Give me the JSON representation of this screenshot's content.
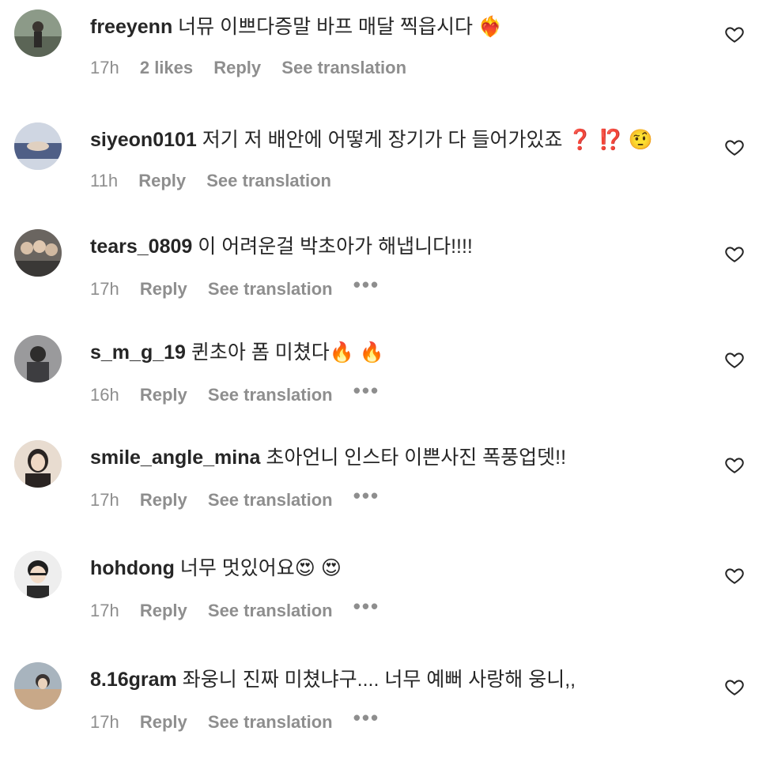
{
  "comments": [
    {
      "username": "freeyenn",
      "text": "너뮤 이쁘다증말 바프 매달 찍읍시다 ❤️‍🔥",
      "time": "17h",
      "likes": "2 likes",
      "reply_label": "Reply",
      "translate_label": "See translation",
      "more": "",
      "avatar_bg": "#6b7a6a"
    },
    {
      "username": "siyeon0101",
      "text": "저기 저 배안에 어떻게 장기가 다 들어가있죠 ❓ ⁉️ 🤨",
      "time": "11h",
      "likes": "",
      "reply_label": "Reply",
      "translate_label": "See translation",
      "more": "",
      "avatar_bg": "#4f5f86"
    },
    {
      "username": "tears_0809",
      "text": "이 어려운걸 박초아가 해냅니다!!!!",
      "time": "17h",
      "likes": "",
      "reply_label": "Reply",
      "translate_label": "See translation",
      "more": "•••",
      "avatar_bg": "#5a5550"
    },
    {
      "username": "s_m_g_19",
      "text": "퀸초아 폼 미쳤다🔥 🔥",
      "time": "16h",
      "likes": "",
      "reply_label": "Reply",
      "translate_label": "See translation",
      "more": "•••",
      "avatar_bg": "#3d3d40"
    },
    {
      "username": "smile_angle_mina",
      "text": "초아언니 인스타 이쁜사진 폭풍업뎃!!",
      "time": "17h",
      "likes": "",
      "reply_label": "Reply",
      "translate_label": "See translation",
      "more": "•••",
      "avatar_bg": "#c9b7a6"
    },
    {
      "username": "hohdong",
      "text": "너무 멋있어요😍 😍",
      "time": "17h",
      "likes": "",
      "reply_label": "Reply",
      "translate_label": "See translation",
      "more": "•••",
      "avatar_bg": "#e6e6e6"
    },
    {
      "username": "8.16gram",
      "text": "좌웅니 진짜 미쳤냐구.... 너무 예뻐 사랑해 웅니,,",
      "time": "17h",
      "likes": "",
      "reply_label": "Reply",
      "translate_label": "See translation",
      "more": "•••",
      "avatar_bg": "#8a9aa8"
    }
  ],
  "icons": {
    "like": "heart-outline-icon",
    "more": "more-options-icon"
  },
  "colors": {
    "text": "#262626",
    "secondary": "#8e8e8e",
    "background": "#ffffff"
  }
}
